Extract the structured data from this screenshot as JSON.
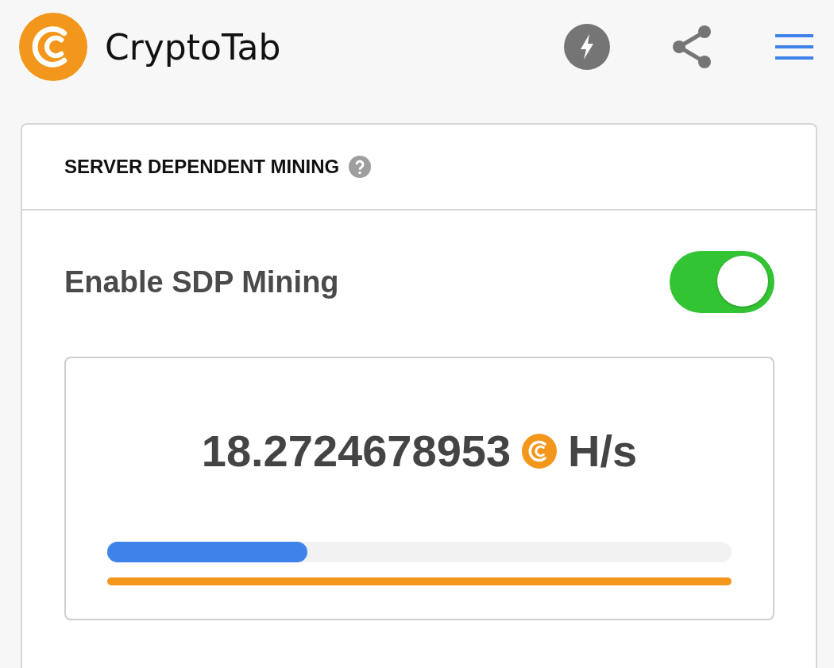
{
  "header": {
    "title": "CryptoTab"
  },
  "card": {
    "title": "SERVER DEPENDENT MINING",
    "toggle": {
      "label": "Enable SDP Mining",
      "on": true
    },
    "hashrate": {
      "value": "18.2724678953",
      "unit": "H/s"
    },
    "progress": {
      "level": 0.32
    }
  }
}
